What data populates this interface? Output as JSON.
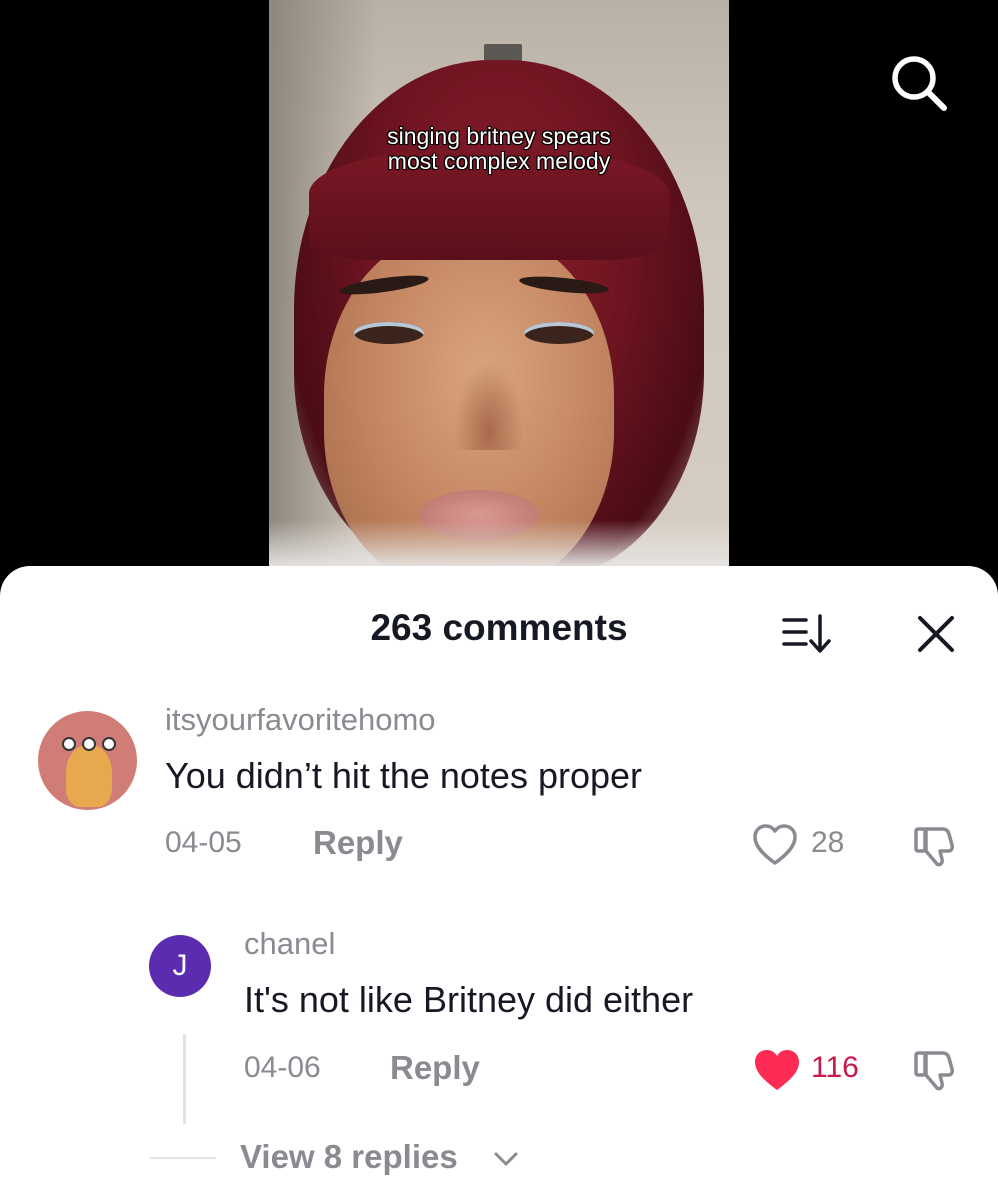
{
  "video": {
    "caption_lines": [
      "singing britney spears",
      "most complex melody"
    ]
  },
  "header_icons": {
    "search": "search-icon"
  },
  "comments_panel": {
    "title": "263 comments",
    "sort_icon": "sort-icon",
    "close_icon": "close-icon"
  },
  "comments": [
    {
      "username": "itsyourfavoritehomo",
      "text": "You didn’t hit the notes proper",
      "date": "04-05",
      "reply_label": "Reply",
      "likes": "28",
      "liked": false
    }
  ],
  "replies": [
    {
      "avatar_initial": "J",
      "avatar_color": "#5b2bb0",
      "username": "chanel",
      "text": "It's not like Britney did either",
      "date": "04-06",
      "reply_label": "Reply",
      "likes": "116",
      "liked": true
    }
  ],
  "view_replies_label": "View 8 replies",
  "colors": {
    "liked": "#fe2c55",
    "muted_text": "#8a8b91",
    "primary_text": "#161823"
  }
}
